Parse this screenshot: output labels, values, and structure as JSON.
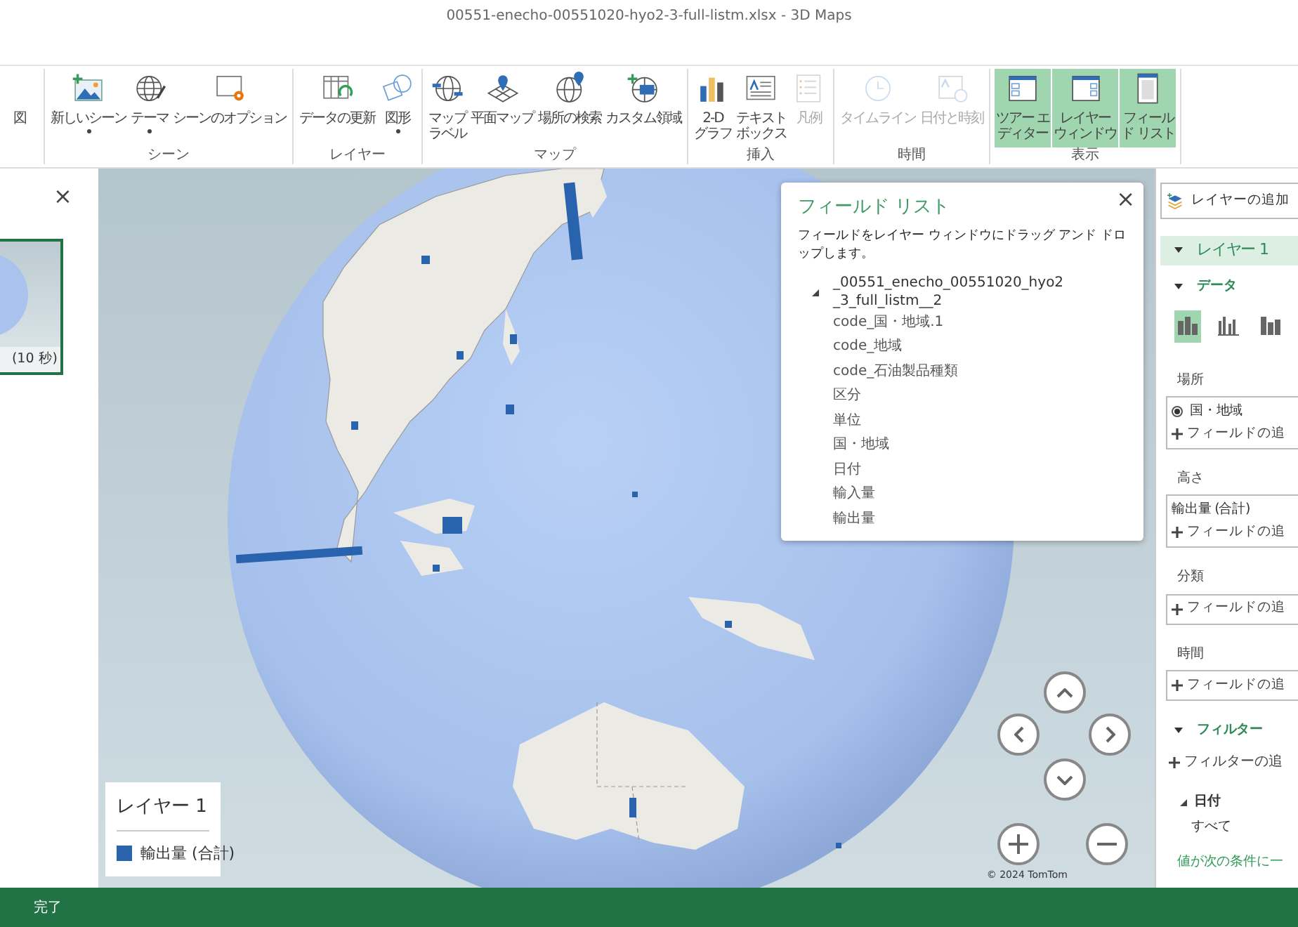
{
  "window": {
    "title": "00551-enecho-00551020-hyo2-3-full-listm.xlsx - 3D Maps"
  },
  "ribbon": {
    "groups": [
      {
        "buttons": [
          {
            "lines": [
              "図"
            ],
            "dropdown": false,
            "disabled": false,
            "selected": false
          }
        ]
      },
      {
        "label": "シーン",
        "buttons": [
          {
            "lines": [
              "新しいシーン"
            ],
            "dropdown": true,
            "disabled": false,
            "selected": false
          },
          {
            "lines": [
              "テーマ"
            ],
            "dropdown": true,
            "disabled": false,
            "selected": false
          },
          {
            "lines": [
              "シーンのオプション"
            ],
            "dropdown": false,
            "disabled": false,
            "selected": false
          }
        ]
      },
      {
        "label": "レイヤー",
        "buttons": [
          {
            "lines": [
              "データの更新"
            ],
            "dropdown": false,
            "disabled": false,
            "selected": false
          },
          {
            "lines": [
              "図形"
            ],
            "dropdown": true,
            "disabled": false,
            "selected": false
          }
        ]
      },
      {
        "label": "マップ",
        "buttons": [
          {
            "lines": [
              "マップ",
              "ラベル"
            ],
            "dropdown": false,
            "disabled": false,
            "selected": false
          },
          {
            "lines": [
              "平面マップ"
            ],
            "dropdown": false,
            "disabled": false,
            "selected": false
          },
          {
            "lines": [
              "場所の検索"
            ],
            "dropdown": false,
            "disabled": false,
            "selected": false
          },
          {
            "lines": [
              "カスタム領域"
            ],
            "dropdown": false,
            "disabled": false,
            "selected": false
          }
        ]
      },
      {
        "label": "挿入",
        "buttons": [
          {
            "lines": [
              "2-D",
              "グラフ"
            ],
            "dropdown": false,
            "disabled": false,
            "selected": false
          },
          {
            "lines": [
              "テキスト",
              "ボックス"
            ],
            "dropdown": false,
            "disabled": false,
            "selected": false
          },
          {
            "lines": [
              "凡例"
            ],
            "dropdown": false,
            "disabled": true,
            "selected": false
          }
        ]
      },
      {
        "label": "時間",
        "buttons": [
          {
            "lines": [
              "タイムライン"
            ],
            "dropdown": false,
            "disabled": true,
            "selected": false
          },
          {
            "lines": [
              "日付と時刻"
            ],
            "dropdown": false,
            "disabled": true,
            "selected": false
          }
        ]
      },
      {
        "label": "表示",
        "buttons": [
          {
            "lines": [
              "ツアー エ",
              "ディター"
            ],
            "dropdown": false,
            "disabled": false,
            "selected": true
          },
          {
            "lines": [
              "レイヤー",
              "ウィンドウ"
            ],
            "dropdown": false,
            "disabled": false,
            "selected": true
          },
          {
            "lines": [
              "フィール",
              "ド リスト"
            ],
            "dropdown": false,
            "disabled": false,
            "selected": true
          }
        ]
      }
    ]
  },
  "tour_panel": {
    "close": "×",
    "scenes": [
      {
        "duration": "(10 秒)",
        "selected": true
      }
    ]
  },
  "map": {
    "copyright": "© 2024 TomTom",
    "legend": {
      "title": "レイヤー 1",
      "items": [
        {
          "label": "輸出量 (合計)",
          "color": "#2a63ad"
        }
      ]
    }
  },
  "field_list": {
    "title": "フィールド リスト",
    "close": "×",
    "hint": "フィールドをレイヤー ウィンドウにドラッグ アンド ドロップします。",
    "tree": [
      {
        "label": "_00551_enecho_00551020_hyo2_3_full_listm__2",
        "expanded": true,
        "children": [
          {
            "label": "code_国・地域.1"
          },
          {
            "label": "code_地域"
          },
          {
            "label": "code_石油製品種類"
          },
          {
            "label": "区分"
          },
          {
            "label": "単位"
          },
          {
            "label": "国・地域"
          },
          {
            "label": "日付"
          },
          {
            "label": "輸入量"
          },
          {
            "label": "輸出量"
          }
        ]
      }
    ]
  },
  "layer_pane": {
    "add_layer": "レイヤーの追加",
    "layers": [
      {
        "name": "レイヤー 1",
        "expanded": true,
        "data": {
          "title": "データ",
          "expanded": true,
          "chart_types": [
            {
              "selected": true
            },
            {
              "selected": false
            },
            {
              "selected": false
            }
          ],
          "wells": [
            {
              "label": "場所",
              "fields": [
                {
                  "label": "国・地域",
                  "checked": true
                }
              ],
              "add": "フィールドの追"
            },
            {
              "label": "高さ",
              "fields": [
                {
                  "label": "輸出量 (合計)"
                }
              ],
              "add": "フィールドの追"
            },
            {
              "label": "分類",
              "add": "フィールドの追"
            },
            {
              "label": "時間",
              "add": "フィールドの追"
            }
          ]
        },
        "filters": {
          "title": "フィルター",
          "expanded": true,
          "add": "フィルターの追",
          "items": [
            {
              "name": "日付",
              "expanded": true,
              "value": "すべて"
            }
          ],
          "condition": "値が次の条件に一"
        }
      }
    ]
  },
  "status_bar": {
    "text": "完了"
  }
}
